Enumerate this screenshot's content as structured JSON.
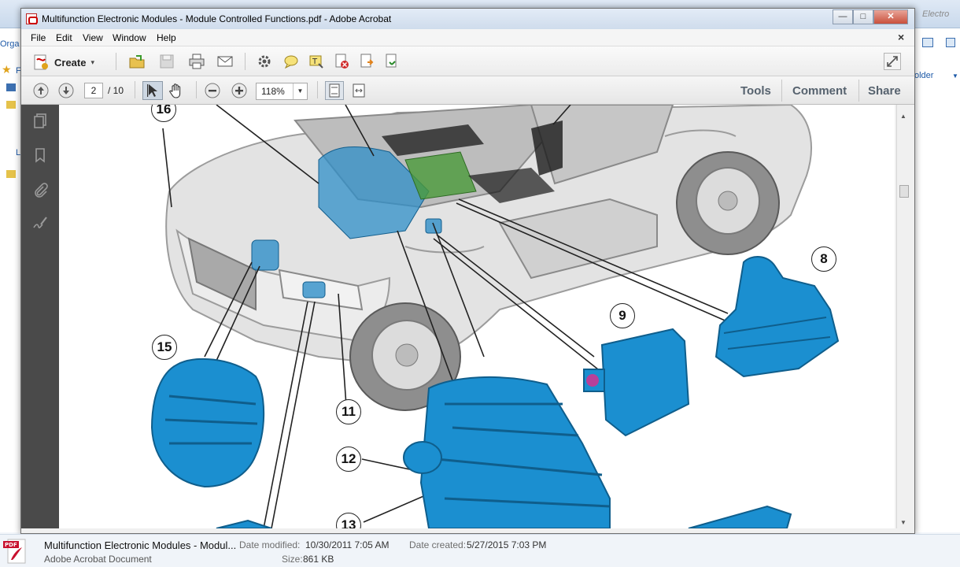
{
  "explorer": {
    "left_fragments": [
      "Orga",
      "F",
      "L"
    ],
    "right_fragments": [
      "Electro",
      "older"
    ],
    "details": {
      "name": "Multifunction Electronic Modules - Modul...",
      "type": "Adobe Acrobat Document",
      "date_modified_label": "Date modified:",
      "date_modified": "10/30/2011 7:05 AM",
      "size_label": "Size:",
      "size": "861 KB",
      "date_created_label": "Date created:",
      "date_created": "5/27/2015 7:03 PM",
      "icon_label": "PDF"
    }
  },
  "window": {
    "title": "Multifunction Electronic Modules - Module Controlled Functions.pdf - Adobe Acrobat",
    "controls": {
      "minimize": "—",
      "maximize": "□",
      "close": "✕"
    }
  },
  "menu": {
    "items": [
      "File",
      "Edit",
      "View",
      "Window",
      "Help"
    ],
    "doc_close": "×"
  },
  "toolbar": {
    "create_label": "Create",
    "create_caret": "▾"
  },
  "nav": {
    "current_page": "2",
    "total_pages": "/ 10",
    "zoom": "118%",
    "zoom_caret": "▼"
  },
  "right_panel": {
    "tools": "Tools",
    "comment": "Comment",
    "share": "Share"
  },
  "diagram": {
    "callouts": [
      "16",
      "15",
      "11",
      "12",
      "13",
      "9",
      "8"
    ],
    "colors": {
      "module_blue": "#1b8fd0",
      "module_dark": "#0f6ea3",
      "car_body": "#d4d4d4",
      "car_line": "#9a9a9a"
    }
  }
}
